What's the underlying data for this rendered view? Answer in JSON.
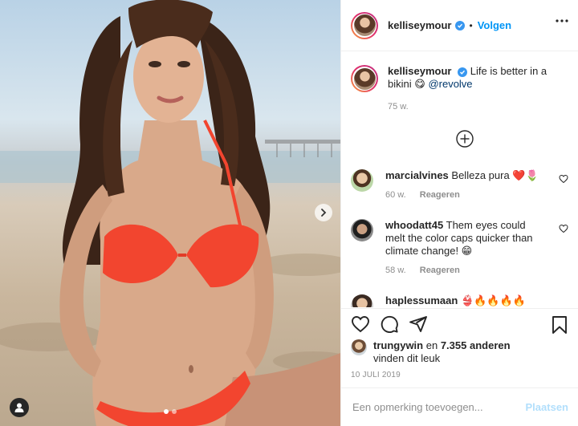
{
  "post": {
    "username": "kelliseymour",
    "verified": true,
    "follow_label": "Volgen",
    "separator": "•",
    "caption_text": "Life is better in a bikini",
    "caption_emoji": "😋",
    "caption_mention": "@revolve",
    "caption_age": "75 w.",
    "image_count": 2,
    "active_image": 1
  },
  "comments": [
    {
      "username": "marcialvines",
      "text": "Belleza pura ❤️🌷",
      "age": "60 w.",
      "reply_label": "Reageren"
    },
    {
      "username": "whoodatt45",
      "text": "Them eyes could melt the color caps quicker than climate change! 😁",
      "age": "58 w.",
      "reply_label": "Reageren"
    },
    {
      "username": "haplessumaan",
      "text": "👙🔥🔥🔥🔥",
      "age": "",
      "reply_label": ""
    }
  ],
  "likes": {
    "user": "trungywin",
    "connector": "en",
    "count_text": "7.355 anderen",
    "suffix": "vinden dit leuk"
  },
  "date": "10 JULI 2019",
  "add_comment": {
    "placeholder": "Een opmerking toevoegen...",
    "post_label": "Plaatsen"
  },
  "colors": {
    "link_blue": "#0095f6",
    "post_disabled": "#b2dffc",
    "mention": "#00376b",
    "verified": "#3897f0",
    "bikini": "#f2452f"
  },
  "icons": [
    "more-icon",
    "verified-icon",
    "add-icon",
    "heart-icon",
    "comment-icon",
    "share-icon",
    "bookmark-icon",
    "chevron-right-icon",
    "user-tag-icon"
  ]
}
